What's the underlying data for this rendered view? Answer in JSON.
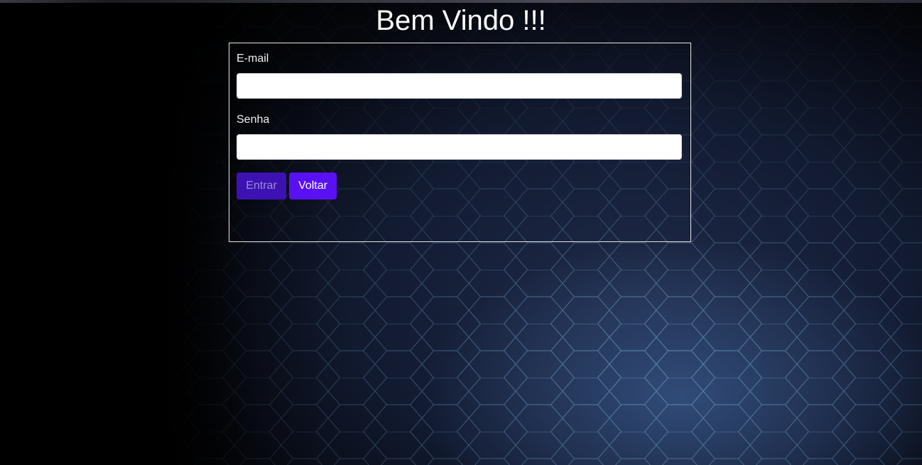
{
  "page": {
    "title": "Bem Vindo !!!"
  },
  "form": {
    "email_label": "E-mail",
    "email_value": "",
    "password_label": "Senha",
    "password_value": "",
    "submit_label": "Entrar",
    "back_label": "Voltar"
  },
  "colors": {
    "submit_button": "#3d12b3",
    "back_button": "#5a10f5",
    "panel_border": "#e6e6e6"
  }
}
